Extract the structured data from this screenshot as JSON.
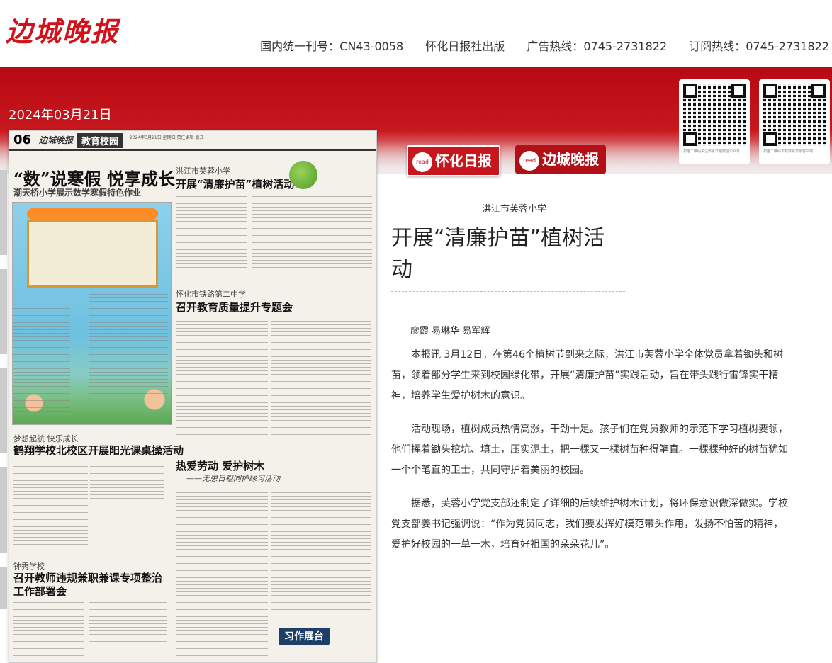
{
  "header": {
    "logo": "边城晚报",
    "info": [
      "国内统一刊号：CN43-0058",
      "怀化日报社出版",
      "广告热线：0745-2731822",
      "订阅热线：0745-2731822"
    ]
  },
  "date": "2024年03月21日",
  "qr_codes": [
    {
      "caption": "扫描二维码关注怀化日报微信公众号"
    },
    {
      "caption": "扫描二维码下载怀化日报客户端"
    }
  ],
  "tabs": [
    {
      "label": "怀化日报",
      "badge": "read",
      "active": true
    },
    {
      "label": "边城晚报",
      "badge": "read",
      "active": false
    }
  ],
  "newspaper": {
    "page_number": "06",
    "brand": "边城晚报",
    "section": "教育校园",
    "meta": "2024年3月21日 星期四  责任编辑 版式",
    "stories": [
      {
        "title": "“数”说寒假 悦享成长",
        "subtitle": "潮天桥小学展示数学寒假特色作业"
      },
      {
        "kicker": "洪江市芙蓉小学",
        "title": "开展“清廉护苗”植树活动"
      },
      {
        "kicker": "怀化市铁路第二中学",
        "title": "召开教育质量提升专题会"
      },
      {
        "kicker": "梦想起航 快乐成长",
        "title": "鹤翔学校北校区开展阳光课桌操活动"
      },
      {
        "title": "热爱劳动 爱护树木",
        "subtitle": "——无患日祖同护绿习活动"
      },
      {
        "kicker": "钟秀学校",
        "title": "召开教师违规兼职兼课专项整治工作部署会"
      }
    ],
    "feature_label": "习作展台"
  },
  "article": {
    "kicker": "洪江市芙蓉小学",
    "title": "开展“清廉护苗”植树活动",
    "author": "廖霞 易琳华 易军辉",
    "paragraphs": [
      "本报讯 3月12日，在第46个植树节到来之际，洪江市芙蓉小学全体党员拿着锄头和树苗，领着部分学生来到校园绿化带，开展“清廉护苗”实践活动，旨在带头践行雷锋实干精神，培养学生爱护树木的意识。",
      "活动现场，植树成员热情高涨，干劲十足。孩子们在党员教师的示范下学习植树要领，他们挥着锄头挖坑、填土，压实泥土，把一棵又一棵树苗种得笔直。一棵棵种好的树苗犹如一个个笔直的卫士，共同守护着美丽的校园。",
      "据悉，芙蓉小学党支部还制定了详细的后续维护树木计划，将环保意识做深做实。学校党支部姜书记强调说：“作为党员同志，我们要发挥好模范带头作用，发扬不怕苦的精神，爱护好校园的一草一木，培育好祖国的朵朵花儿”。"
    ]
  },
  "colors": {
    "brand_red": "#d4111a",
    "band_red": "#c2121a"
  }
}
